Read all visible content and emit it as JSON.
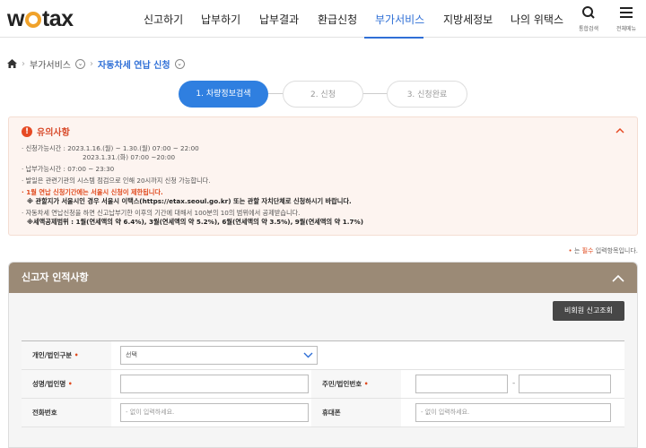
{
  "header": {
    "logo": "wetax",
    "nav": [
      "신고하기",
      "납부하기",
      "납부결과",
      "환급신청",
      "부가서비스",
      "지방세정보",
      "나의 위택스"
    ],
    "search_label": "통합검색",
    "menu_label": "전체메뉴"
  },
  "breadcrumb": {
    "home": "⌂",
    "level1": "부가서비스",
    "level2": "자동차세 연납 신청"
  },
  "steps": [
    "1. 차량정보검색",
    "2. 신청",
    "3. 신청완료"
  ],
  "notice": {
    "title": "유의사항",
    "lines": [
      "· 신청가능시간 : 2023.1.16.(월) ~ 1.30.(월) 07:00 ~ 22:00",
      "2023.1.31.(화) 07:00 ~20:00",
      "· 납부가능시간 : 07:00 ~ 23:30",
      "· 발일은 관련기관의 시스템 점검으로 인해 20시까지 신청 가능합니다.",
      "· 1월 연납 신청기간에는 서울시 신청이 제한됩니다.",
      "※ 관할지가 서울시인 경우 서울시 이택스(https://etax.seoul.go.kr) 또는 관할 자치단체로 신청하시기 바랍니다.",
      "· 자동차세 연납신청을 하면 신고납부기한 이후의 기간에 대해서 100분의 10의 범위에서 공제받습니다.",
      "※세액공제범위 : 1월(연세액의 약 6.4%), 3월(연세액의 약 5.2%), 6월(연세액의 약 3.5%), 9월(연세액의 약 1.7%)"
    ]
  },
  "required_note": {
    "mark": "•",
    "prefix": " 는 ",
    "word": "필수",
    "suffix": " 입력항목입니다."
  },
  "panel": {
    "title": "신고자 인적사항",
    "lookup_button": "비회원 신고조회",
    "fields": {
      "type_label": "개인/법인구분",
      "type_value": "선택",
      "name_label": "성명/법인명",
      "id_label": "주민/법인번호",
      "phone_label": "전화번호",
      "phone_placeholder": "- 없이 입력하세요.",
      "mobile_label": "휴대폰",
      "mobile_placeholder": "- 없이 입력하세요."
    },
    "required_mark": "•"
  }
}
